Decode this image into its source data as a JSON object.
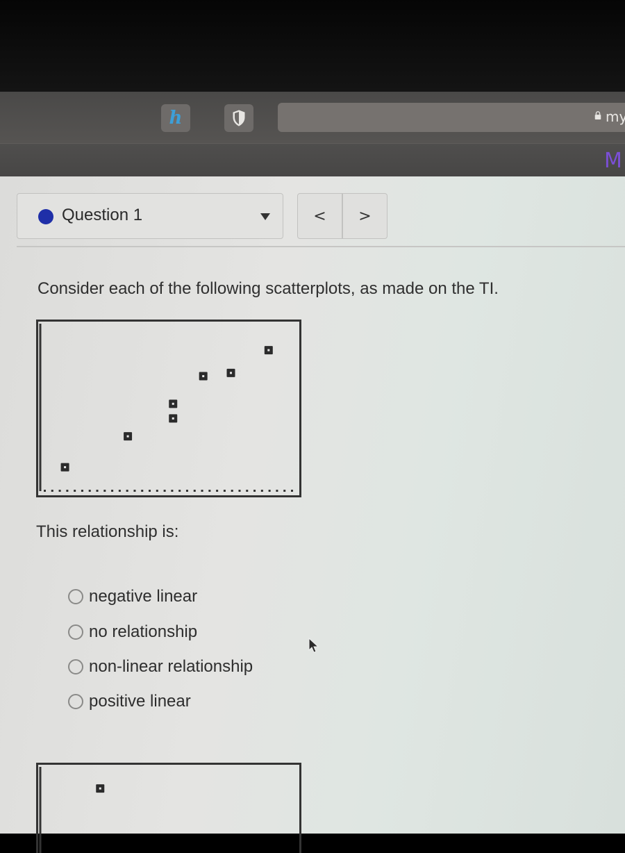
{
  "browser": {
    "extensions": [
      {
        "name": "honey-extension",
        "glyph": "h"
      },
      {
        "name": "privacy-shield-extension",
        "glyph": "shield"
      }
    ],
    "url_text": "my",
    "tab_logo": "M"
  },
  "question_nav": {
    "selected_question": "Question 1",
    "status_color": "#1f2fa8",
    "prev_label": "<",
    "next_label": ">"
  },
  "prompt": "Consider each of the following scatterplots, as made on the TI.",
  "relationship_prompt": "This relationship is:",
  "options": [
    {
      "label": "negative linear",
      "selected": false
    },
    {
      "label": "no relationship",
      "selected": false
    },
    {
      "label": "non-linear relationship",
      "selected": false
    },
    {
      "label": "positive linear",
      "selected": false
    }
  ],
  "chart_data": [
    {
      "type": "scatter",
      "title": "",
      "xlabel": "",
      "ylabel": "",
      "xlim": [
        0,
        10
      ],
      "ylim": [
        0,
        10
      ],
      "grid": false,
      "x_axis_tick_marks": true,
      "points": [
        {
          "x": 0.9,
          "y": 1.3
        },
        {
          "x": 3.4,
          "y": 3.2
        },
        {
          "x": 5.2,
          "y": 4.3
        },
        {
          "x": 5.2,
          "y": 5.2
        },
        {
          "x": 6.4,
          "y": 6.9
        },
        {
          "x": 7.5,
          "y": 7.1
        },
        {
          "x": 9.0,
          "y": 8.5
        }
      ]
    },
    {
      "type": "scatter",
      "title": "",
      "xlabel": "",
      "ylabel": "",
      "xlim": [
        0,
        10
      ],
      "ylim": [
        0,
        10
      ],
      "partially_visible": true,
      "points": [
        {
          "x": 2.3,
          "y": 8.8
        }
      ]
    }
  ]
}
